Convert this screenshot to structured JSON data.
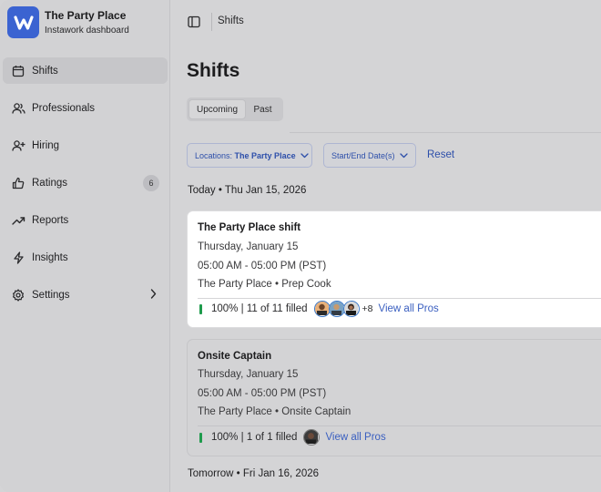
{
  "brand": {
    "name": "The Party Place",
    "subtitle": "Instawork dashboard",
    "logo_letter": "W",
    "color": "#3b63d1"
  },
  "sidebar": {
    "items": [
      {
        "label": "Shifts",
        "icon": "calendar-icon",
        "active": true
      },
      {
        "label": "Professionals",
        "icon": "users-icon"
      },
      {
        "label": "Hiring",
        "icon": "user-plus-icon"
      },
      {
        "label": "Ratings",
        "icon": "thumbs-up-icon",
        "badge": "6"
      },
      {
        "label": "Reports",
        "icon": "trending-up-icon"
      },
      {
        "label": "Insights",
        "icon": "lightning-icon"
      },
      {
        "label": "Settings",
        "icon": "gear-icon",
        "has_submenu": true
      }
    ]
  },
  "topbar": {
    "title": "Shifts"
  },
  "page": {
    "title": "Shifts"
  },
  "tabs": [
    {
      "label": "Upcoming",
      "active": true
    },
    {
      "label": "Past"
    }
  ],
  "filters": {
    "location_prefix": "Locations:",
    "location_value": "The Party Place",
    "date_label": "Start/End Date(s)",
    "reset_label": "Reset"
  },
  "days": [
    {
      "heading": "Today • Thu Jan 15, 2026",
      "shifts": [
        {
          "title": "The Party Place shift",
          "date": "Thursday, January 15",
          "time": "05:00 AM - 05:00 PM (PST)",
          "location_role": "The Party Place • Prep Cook",
          "fill_percent": "100% |",
          "filled_text": "11 of 11 filled",
          "extra_count": "+8",
          "view_label": "View all Pros",
          "highlighted": true
        },
        {
          "title": "Onsite Captain",
          "date": "Thursday, January 15",
          "time": "05:00 AM - 05:00 PM (PST)",
          "location_role": "The Party Place • Onsite Captain",
          "fill_percent": "100% |",
          "filled_text": "1 of 1 filled",
          "view_label": "View all Pros",
          "highlighted": false
        }
      ]
    },
    {
      "heading": "Tomorrow • Fri Jan 16, 2026"
    }
  ],
  "colors": {
    "accent": "#2d4faa",
    "fill_green": "#1e9b4c"
  }
}
